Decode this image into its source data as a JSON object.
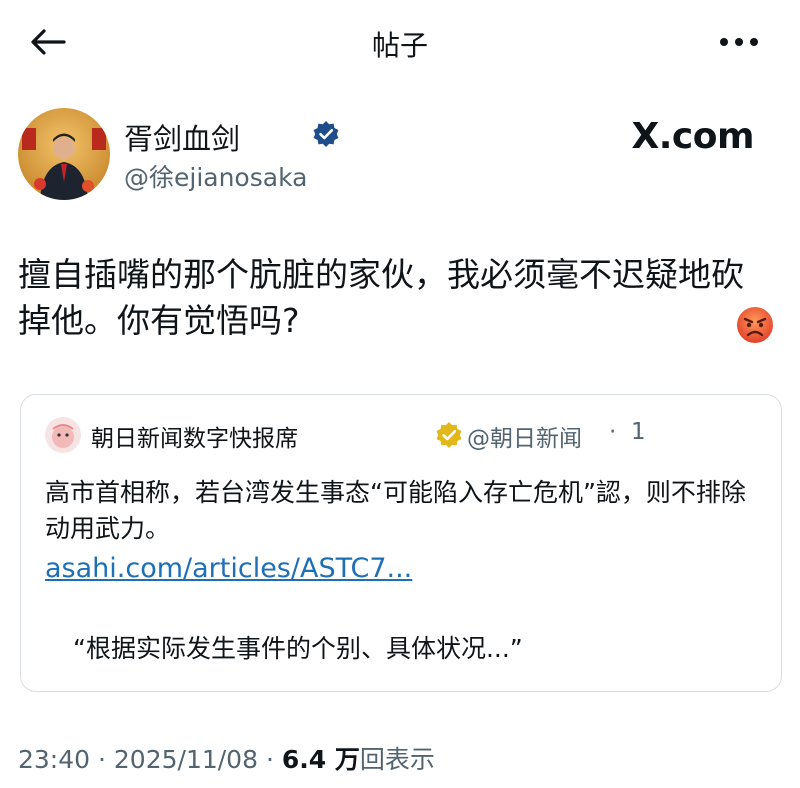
{
  "header": {
    "title": "帖子"
  },
  "post": {
    "author": {
      "display_name": "胥剑血剑",
      "handle": "@徐ejianosaka"
    },
    "source_brand": "X.com",
    "text": "擅自插嘴的那个肮脏的家伙，我必须毫不迟疑地砍掉他。你有觉悟吗?",
    "reaction_emoji": "angry-face",
    "meta": {
      "time": "23:40",
      "separator": "·",
      "date": "2025/11/08",
      "views_count": "6.4 万",
      "views_label": "回表示"
    }
  },
  "quote": {
    "author": {
      "display_name": "朝日新闻数字快报席",
      "handle": "@朝日新闻",
      "separator": "·",
      "time": "1"
    },
    "text": "高市首相称，若台湾发生事态“可能陷入存亡危机”認，则不排除动用武力。",
    "link": "asahi.com/articles/ASTC7...",
    "excerpt": "“根据实际发生事件的个别、具体状况...”"
  },
  "colors": {
    "verified_blue": "#1d4e89",
    "verified_gold": "#e2b719",
    "link_blue": "#1d6fb8",
    "muted_text": "#536471"
  },
  "icons": {
    "back": "back-arrow-icon",
    "more": "more-dots-icon",
    "verified": "verified-badge-icon",
    "gold_verified": "gold-verified-badge-icon"
  }
}
